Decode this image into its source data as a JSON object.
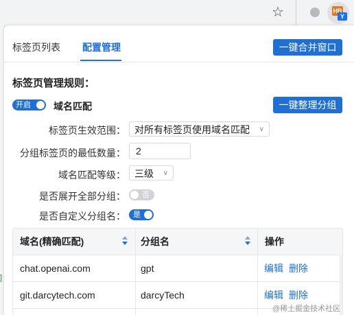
{
  "browser": {
    "ext_logo_text": "HB",
    "ext_badge_text": "Y"
  },
  "tabs": [
    {
      "label": "标签页列表"
    },
    {
      "label": "配置管理"
    }
  ],
  "merge_button_label": "一键合并窗口",
  "section_title": "标签页管理规则：",
  "domain_match": {
    "switch_text": "开启",
    "label": "域名匹配"
  },
  "organize_button_label": "一键整理分组",
  "form": {
    "scope_label": "标签页生效范围：",
    "scope_value": "对所有标签页使用域名匹配",
    "min_count_label": "分组标签页的最低数量：",
    "min_count_value": "2",
    "level_label": "域名匹配等级：",
    "level_value": "三级",
    "expand_label": "是否展开全部分组：",
    "expand_switch_text": "否",
    "custom_name_label": "是否自定义分组名：",
    "custom_name_switch_text": "是"
  },
  "table": {
    "headers": {
      "domain": "域名(精确匹配)",
      "group": "分组名",
      "actions": "操作"
    },
    "rows": [
      {
        "domain": "chat.openai.com",
        "group": "gpt",
        "edit": "编辑",
        "delete": "删除"
      },
      {
        "domain": "git.darcytech.com",
        "group": "darcyTech",
        "edit": "编辑",
        "delete": "删除"
      }
    ]
  },
  "watermark": "@稀土掘金技术社区",
  "colors": {
    "accent": "#1f6fd6",
    "switch_off": "#cfd2d6"
  }
}
